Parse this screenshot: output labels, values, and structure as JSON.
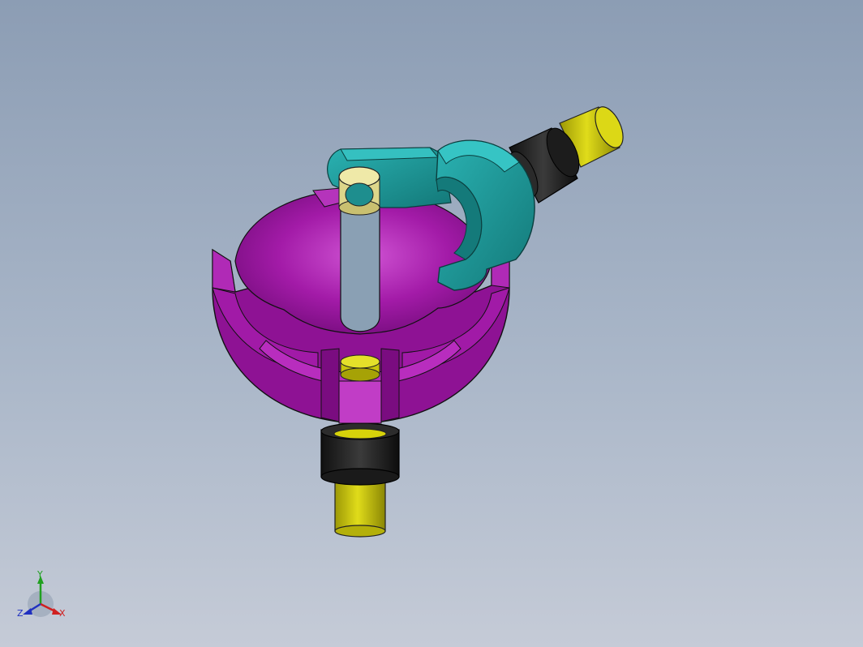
{
  "viewport": {
    "background_top": "#8c9db4",
    "background_bottom": "#c5cbd7"
  },
  "model": {
    "parts": [
      {
        "name": "sphere-cage",
        "color": "#a216a8"
      },
      {
        "name": "link-arm",
        "color": "#1d9a9a"
      },
      {
        "name": "yoke-clamp",
        "color": "#1d9a9a"
      },
      {
        "name": "upper-shaft",
        "color": "#d6d20a"
      },
      {
        "name": "lower-shaft",
        "color": "#d6d20a"
      },
      {
        "name": "bearing-collar",
        "color": "#2a2a2a"
      },
      {
        "name": "pivot-bushing",
        "color": "#e6e08c"
      }
    ]
  },
  "triad": {
    "x_label": "X",
    "y_label": "Y",
    "z_label": "Z",
    "x_color": "#d02020",
    "y_color": "#20a020",
    "z_color": "#2030c0"
  }
}
